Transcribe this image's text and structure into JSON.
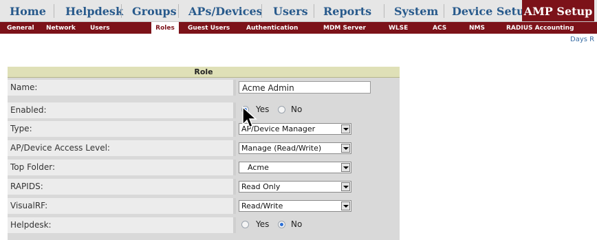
{
  "top_nav": {
    "tabs": [
      {
        "label": "Home"
      },
      {
        "label": "Helpdesk"
      },
      {
        "label": "Groups"
      },
      {
        "label": "APs/Devices"
      },
      {
        "label": "Users"
      },
      {
        "label": "Reports"
      },
      {
        "label": "System"
      },
      {
        "label": "Device Setup"
      },
      {
        "label": "AMP Setup",
        "active": true
      }
    ]
  },
  "sub_nav": {
    "items": [
      {
        "label": "General"
      },
      {
        "label": "Network"
      },
      {
        "label": "Users"
      },
      {
        "label": "Roles",
        "active": true
      },
      {
        "label": "Guest Users"
      },
      {
        "label": "Authentication"
      },
      {
        "label": "MDM Server"
      },
      {
        "label": "WLSE"
      },
      {
        "label": "ACS"
      },
      {
        "label": "NMS"
      },
      {
        "label": "RADIUS Accounting"
      }
    ]
  },
  "days_link": "Days R",
  "role_form": {
    "header": "Role",
    "name": {
      "label": "Name:",
      "value": "Acme Admin"
    },
    "enabled": {
      "label": "Enabled:",
      "yes": "Yes",
      "no": "No",
      "selected": "Yes"
    },
    "type": {
      "label": "Type:",
      "value": "AP/Device Manager"
    },
    "access_level": {
      "label": "AP/Device Access Level:",
      "value": "Manage (Read/Write)"
    },
    "top_folder": {
      "label": "Top Folder:",
      "value": "Acme"
    },
    "rapids": {
      "label": "RAPIDS:",
      "value": "Read Only"
    },
    "visualrf": {
      "label": "VisualRF:",
      "value": "Read/Write"
    },
    "helpdesk": {
      "label": "Helpdesk:",
      "yes": "Yes",
      "no": "No",
      "selected": "No"
    }
  },
  "colors": {
    "brand_red": "#7c1219",
    "nav_blue": "#285a8c",
    "header_tan": "#dfe0b7"
  }
}
